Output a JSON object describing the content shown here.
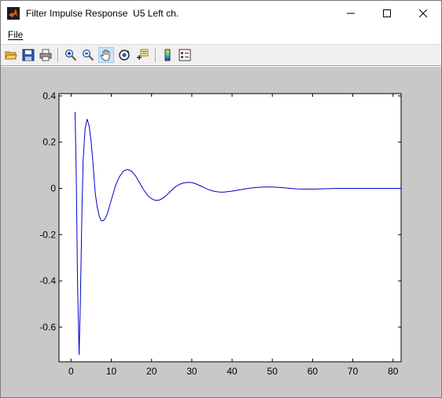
{
  "window": {
    "title": "Filter Impulse Response  U5 Left ch.",
    "controls": [
      "minimize-icon",
      "maximize-icon",
      "close-icon"
    ]
  },
  "menu": {
    "items": [
      {
        "label": "File"
      }
    ]
  },
  "toolbar": {
    "buttons": [
      {
        "icon": "open-folder-icon"
      },
      {
        "icon": "save-icon"
      },
      {
        "icon": "print-icon"
      },
      {
        "icon": "zoom-in-icon"
      },
      {
        "icon": "zoom-out-icon"
      },
      {
        "icon": "pan-hand-icon",
        "active": true
      },
      {
        "icon": "rotate-3d-icon"
      },
      {
        "icon": "data-cursor-icon"
      },
      {
        "icon": "colorbar-icon"
      },
      {
        "icon": "legend-icon"
      }
    ]
  },
  "colors": {
    "figure_bg": "#c8c8c8",
    "axes_bg": "#ffffff",
    "line": "#0000cc",
    "toolbar_active": "#cce4f7"
  },
  "chart_data": {
    "type": "line",
    "xlim": [
      -3,
      82
    ],
    "ylim": [
      -0.75,
      0.41
    ],
    "xticks": [
      0,
      10,
      20,
      30,
      40,
      50,
      60,
      70,
      80
    ],
    "yticks": [
      0.4,
      0.2,
      0,
      -0.2,
      -0.4,
      -0.6
    ],
    "xtick_labels": [
      "0",
      "10",
      "20",
      "30",
      "40",
      "50",
      "60",
      "70",
      "80"
    ],
    "ytick_labels": [
      "0.4",
      "0.2",
      "0",
      "-0.2",
      "-0.4",
      "-0.6"
    ],
    "grid": false,
    "series": [
      {
        "color": "#0000cc",
        "x": [
          1,
          1.3,
          1.6,
          2,
          2.3,
          2.7,
          3,
          3.5,
          4,
          4.5,
          5,
          5.5,
          6,
          6.5,
          7,
          7.5,
          8,
          8.5,
          9,
          9.5,
          10,
          11,
          12,
          13,
          14,
          15,
          16,
          17,
          18,
          19,
          20,
          21,
          22,
          23,
          24,
          25,
          26,
          27,
          28,
          29,
          30,
          31,
          32,
          33,
          34,
          35,
          36,
          37,
          38,
          39,
          40,
          42,
          44,
          46,
          48,
          50,
          52,
          54,
          56,
          58,
          60,
          62,
          64,
          66,
          68,
          70,
          75,
          82
        ],
        "y": [
          0.33,
          0.05,
          -0.4,
          -0.72,
          -0.5,
          -0.1,
          0.12,
          0.26,
          0.3,
          0.27,
          0.2,
          0.1,
          -0.02,
          -0.08,
          -0.12,
          -0.14,
          -0.14,
          -0.13,
          -0.11,
          -0.08,
          -0.05,
          0.01,
          0.05,
          0.075,
          0.082,
          0.075,
          0.055,
          0.025,
          -0.005,
          -0.03,
          -0.045,
          -0.052,
          -0.05,
          -0.04,
          -0.025,
          -0.008,
          0.008,
          0.018,
          0.024,
          0.026,
          0.025,
          0.02,
          0.012,
          0.004,
          -0.004,
          -0.01,
          -0.014,
          -0.016,
          -0.016,
          -0.014,
          -0.012,
          -0.006,
          0.0,
          0.004,
          0.006,
          0.006,
          0.004,
          0.001,
          -0.002,
          -0.003,
          -0.003,
          -0.002,
          -0.001,
          0.0,
          0.0,
          0.0,
          0.0,
          0.0
        ]
      }
    ]
  }
}
